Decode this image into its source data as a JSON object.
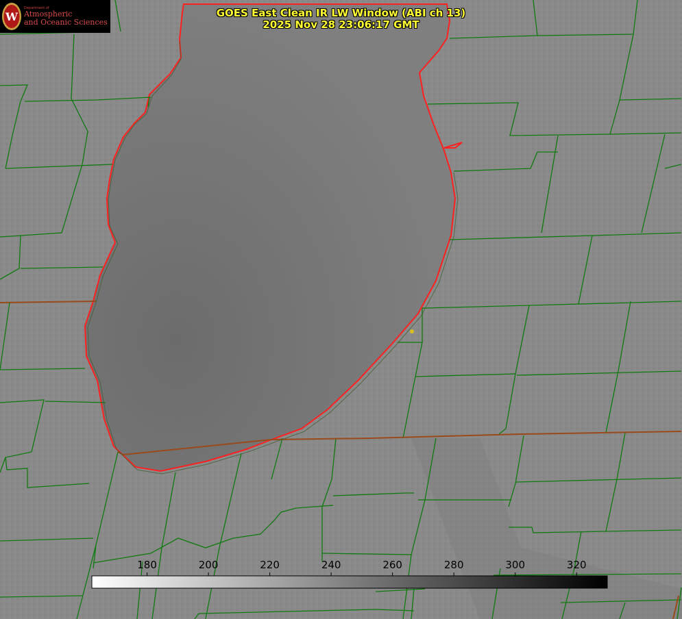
{
  "title": {
    "line1": "GOES East Clean IR LW Window (ABI ch 13)",
    "line2": "2025 Nov 28 23:06:17 GMT"
  },
  "logo": {
    "dept": "Department of",
    "line1": "Atmospheric",
    "line2": "and Oceanic Sciences",
    "seal_letter": "W"
  },
  "colorbar": {
    "ticks": [
      180,
      200,
      220,
      240,
      260,
      280,
      300,
      320
    ],
    "range": [
      162,
      330
    ],
    "gradient_from": "#ffffff",
    "gradient_to": "#000000"
  },
  "colors": {
    "background": "#8a8a8a",
    "lake": "#7c7c7c",
    "county_lines": "#0f7a0f",
    "state_lines": "#9a4a1a",
    "coastline": "#ff2020",
    "title_text": "#ffff33",
    "marker": "#d8c020"
  }
}
